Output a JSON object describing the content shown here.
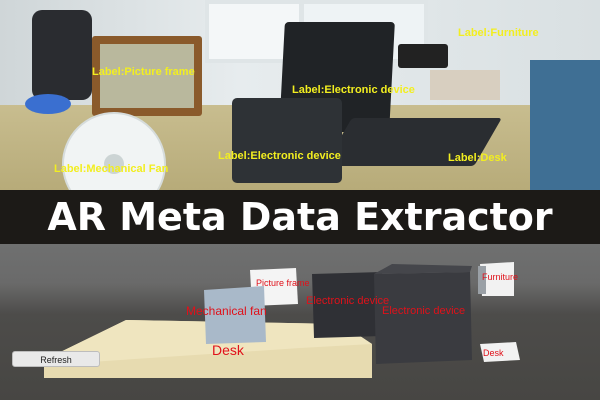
{
  "photo": {
    "labels": {
      "picture_frame": "Label:Picture frame",
      "electronic_device_1": "Label:Electronic device",
      "electronic_device_2": "Label:Electronic device",
      "furniture": "Label:Furniture",
      "mechanical_fan": "Label:Mechanical Fan",
      "desk": "Label:Desk"
    },
    "label_color": "#f2ee20"
  },
  "title": "AR Meta Data Extractor",
  "scene": {
    "tags": {
      "picture_frame": "Picture frame",
      "mechanical_fan": "Mechanical fan",
      "electronic_device_1": "Electronic device",
      "electronic_device_2": "Electronic device",
      "furniture": "Furniture",
      "desk_small": "Desk",
      "desk": "Desk"
    },
    "tag_color": "#e0111a",
    "refresh_label": "Refresh"
  }
}
